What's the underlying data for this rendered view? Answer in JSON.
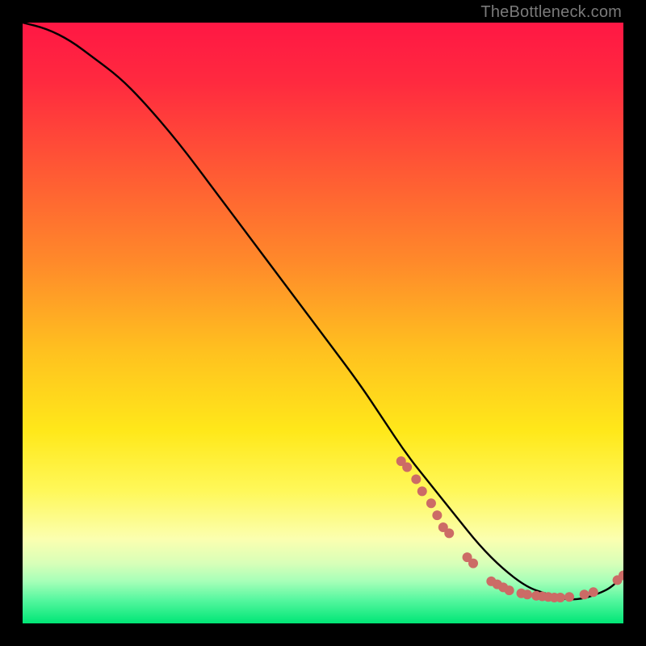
{
  "watermark": "TheBottleneck.com",
  "chart_data": {
    "type": "line",
    "title": "",
    "xlabel": "",
    "ylabel": "",
    "xlim": [
      0,
      100
    ],
    "ylim": [
      0,
      100
    ],
    "grid": false,
    "legend": false,
    "background_gradient_stops": [
      {
        "offset": 0.0,
        "color": "#ff1744"
      },
      {
        "offset": 0.1,
        "color": "#ff2a3f"
      },
      {
        "offset": 0.25,
        "color": "#ff5a34"
      },
      {
        "offset": 0.4,
        "color": "#ff8a2a"
      },
      {
        "offset": 0.55,
        "color": "#ffc21f"
      },
      {
        "offset": 0.68,
        "color": "#ffe81a"
      },
      {
        "offset": 0.78,
        "color": "#fff85a"
      },
      {
        "offset": 0.86,
        "color": "#fbffb0"
      },
      {
        "offset": 0.9,
        "color": "#d8ffb8"
      },
      {
        "offset": 0.93,
        "color": "#a6ffb8"
      },
      {
        "offset": 0.96,
        "color": "#58f7a0"
      },
      {
        "offset": 1.0,
        "color": "#00e676"
      }
    ],
    "series": [
      {
        "name": "bottleneck-curve",
        "color": "#000000",
        "x": [
          0,
          4,
          8,
          12,
          16,
          20,
          26,
          32,
          38,
          44,
          50,
          56,
          60,
          64,
          68,
          72,
          76,
          80,
          84,
          87,
          90,
          93,
          96,
          98,
          100
        ],
        "y": [
          100,
          99,
          97,
          94,
          91,
          87,
          80,
          72,
          64,
          56,
          48,
          40,
          34,
          28,
          23,
          18,
          13,
          9,
          6,
          5,
          4,
          4,
          5,
          6,
          8
        ]
      }
    ],
    "marker_points": {
      "name": "sample-points",
      "color": "#cc6b66",
      "radius": 6,
      "points": [
        {
          "x": 63,
          "y": 27
        },
        {
          "x": 64,
          "y": 26
        },
        {
          "x": 65.5,
          "y": 24
        },
        {
          "x": 66.5,
          "y": 22
        },
        {
          "x": 68,
          "y": 20
        },
        {
          "x": 69,
          "y": 18
        },
        {
          "x": 70,
          "y": 16
        },
        {
          "x": 71,
          "y": 15
        },
        {
          "x": 74,
          "y": 11
        },
        {
          "x": 75,
          "y": 10
        },
        {
          "x": 78,
          "y": 7
        },
        {
          "x": 79,
          "y": 6.5
        },
        {
          "x": 80,
          "y": 6
        },
        {
          "x": 81,
          "y": 5.5
        },
        {
          "x": 83,
          "y": 5
        },
        {
          "x": 84,
          "y": 4.8
        },
        {
          "x": 85.5,
          "y": 4.6
        },
        {
          "x": 86.5,
          "y": 4.5
        },
        {
          "x": 87.5,
          "y": 4.4
        },
        {
          "x": 88.5,
          "y": 4.3
        },
        {
          "x": 89.5,
          "y": 4.3
        },
        {
          "x": 91,
          "y": 4.4
        },
        {
          "x": 93.5,
          "y": 4.8
        },
        {
          "x": 95,
          "y": 5.2
        },
        {
          "x": 99,
          "y": 7.2
        },
        {
          "x": 100,
          "y": 8
        }
      ]
    }
  }
}
